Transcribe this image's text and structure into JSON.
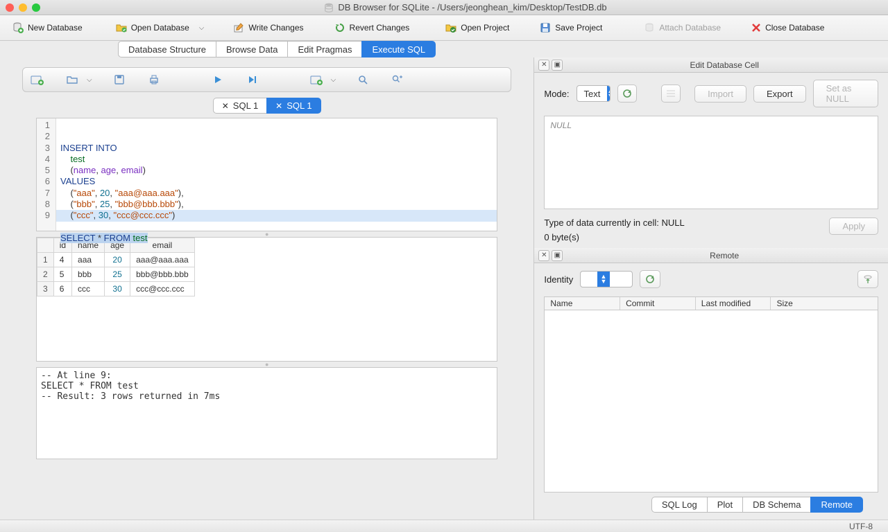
{
  "window": {
    "title": "DB Browser for SQLite - /Users/jeonghean_kim/Desktop/TestDB.db"
  },
  "toolbar": {
    "new_db": "New Database",
    "open_db": "Open Database",
    "write_changes": "Write Changes",
    "revert_changes": "Revert Changes",
    "open_project": "Open Project",
    "save_project": "Save Project",
    "attach_db": "Attach Database",
    "close_db": "Close Database"
  },
  "main_tabs": {
    "structure": "Database Structure",
    "browse": "Browse Data",
    "pragmas": "Edit Pragmas",
    "execute": "Execute SQL"
  },
  "sql_tabs": {
    "t1": "SQL 1",
    "t2": "SQL 1"
  },
  "editor_lines": [
    "1",
    "2",
    "3",
    "4",
    "5",
    "6",
    "7",
    "8",
    "9"
  ],
  "results": {
    "headers": {
      "rownum": "",
      "id": "id",
      "name": "name",
      "age": "age",
      "email": "email"
    },
    "rows": [
      {
        "n": "1",
        "id": "4",
        "name": "aaa",
        "age": "20",
        "email": "aaa@aaa.aaa"
      },
      {
        "n": "2",
        "id": "5",
        "name": "bbb",
        "age": "25",
        "email": "bbb@bbb.bbb"
      },
      {
        "n": "3",
        "id": "6",
        "name": "ccc",
        "age": "30",
        "email": "ccc@ccc.ccc"
      }
    ]
  },
  "console": "-- At line 9:\nSELECT * FROM test\n-- Result: 3 rows returned in 7ms",
  "cell_panel": {
    "title": "Edit Database Cell",
    "mode_label": "Mode:",
    "mode_value": "Text",
    "import": "Import",
    "export": "Export",
    "set_null": "Set as NULL",
    "placeholder": "NULL",
    "type_info": "Type of data currently in cell: NULL",
    "size_info": "0 byte(s)",
    "apply": "Apply"
  },
  "remote_panel": {
    "title": "Remote",
    "identity_label": "Identity",
    "cols": {
      "name": "Name",
      "commit": "Commit",
      "modified": "Last modified",
      "size": "Size"
    }
  },
  "bottom_tabs": {
    "sqllog": "SQL Log",
    "plot": "Plot",
    "schema": "DB Schema",
    "remote": "Remote"
  },
  "status": {
    "encoding": "UTF-8"
  }
}
